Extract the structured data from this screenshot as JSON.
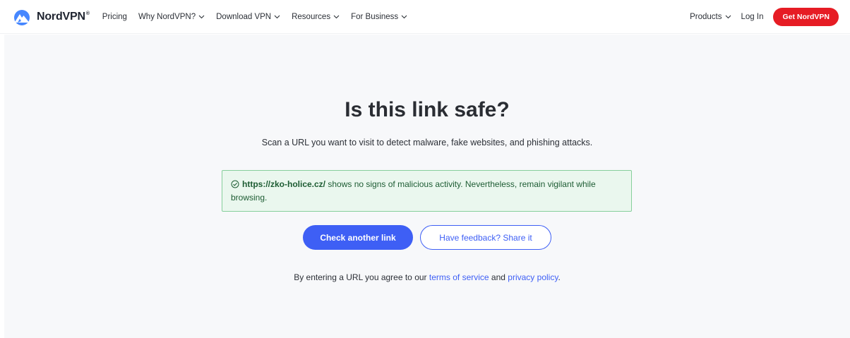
{
  "nav": {
    "logo_text": "NordVPN",
    "logo_mark": "®",
    "items": [
      {
        "label": "Pricing"
      },
      {
        "label": "Why NordVPN?"
      },
      {
        "label": "Download VPN"
      },
      {
        "label": "Resources"
      },
      {
        "label": "For Business"
      }
    ],
    "products": "Products",
    "login": "Log In",
    "cta": "Get NordVPN"
  },
  "main": {
    "title": "Is this link safe?",
    "subtitle": "Scan a URL you want to visit to detect malware, fake websites, and phishing attacks.",
    "result": {
      "icon": "check-circle-icon",
      "url": "https://zko-holice.cz/",
      "message": "shows no signs of malicious activity. Nevertheless, remain vigilant while browsing."
    },
    "check_another_label": "Check another link",
    "feedback_label": "Have feedback? Share it",
    "terms": {
      "prefix": "By entering a URL you agree to our",
      "tos": "terms of service",
      "and": "and",
      "privacy": "privacy policy",
      "suffix": "."
    }
  },
  "colors": {
    "brand_red": "#e61c24",
    "primary_blue": "#3e5ff5",
    "success_bg": "#eaf7ee",
    "success_border": "#86cf9b"
  }
}
